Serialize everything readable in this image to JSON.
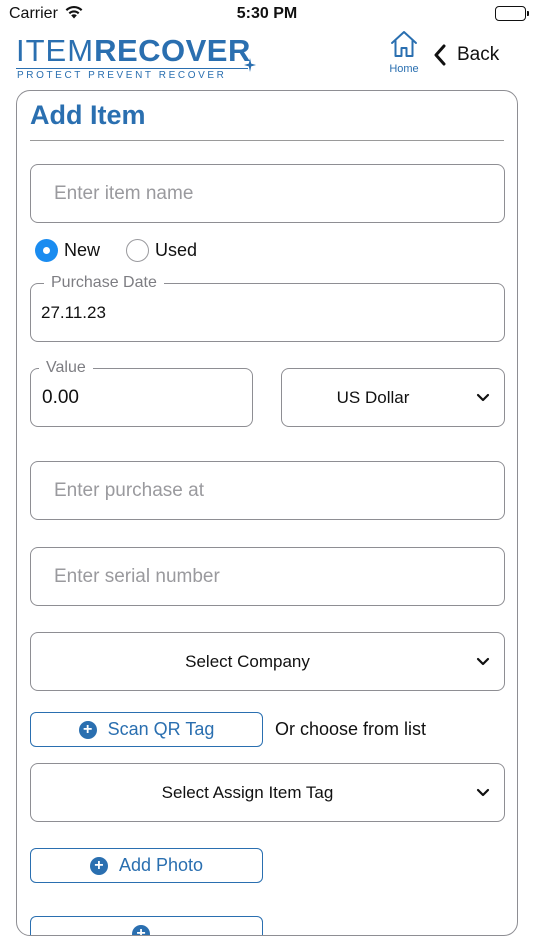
{
  "status_bar": {
    "carrier": "Carrier",
    "time": "5:30 PM"
  },
  "header": {
    "logo_thin": "ITEM",
    "logo_bold": "RECOVER",
    "logo_tagline": "PROTECT PREVENT RECOVER",
    "home_label": "Home",
    "back_label": "Back"
  },
  "form": {
    "title": "Add Item",
    "item_name": {
      "placeholder": "Enter item name",
      "value": ""
    },
    "condition": {
      "options": [
        "New",
        "Used"
      ],
      "selected": "New"
    },
    "purchase_date": {
      "label": "Purchase Date",
      "value": "27.11.23"
    },
    "value": {
      "label": "Value",
      "value": "0.00"
    },
    "currency": {
      "selected": "US Dollar"
    },
    "purchased_at": {
      "placeholder": "Enter purchase at",
      "value": ""
    },
    "serial_number": {
      "placeholder": "Enter serial number",
      "value": ""
    },
    "company": {
      "selected": "Select Company"
    },
    "scan_qr_label": "Scan QR Tag",
    "or_choose_text": "Or choose from list",
    "assign_tag": {
      "selected": "Select Assign Item Tag"
    },
    "add_photo_label": "Add Photo"
  },
  "colors": {
    "brand": "#2a6fb0",
    "radio_selected": "#1a8cf0",
    "border": "#8e8e93"
  },
  "icons": {
    "home": "home-icon",
    "back": "chevron-left-icon",
    "select": "chevron-down-icon",
    "add": "plus-circle-icon",
    "wifi": "wifi-icon",
    "battery": "battery-icon"
  }
}
